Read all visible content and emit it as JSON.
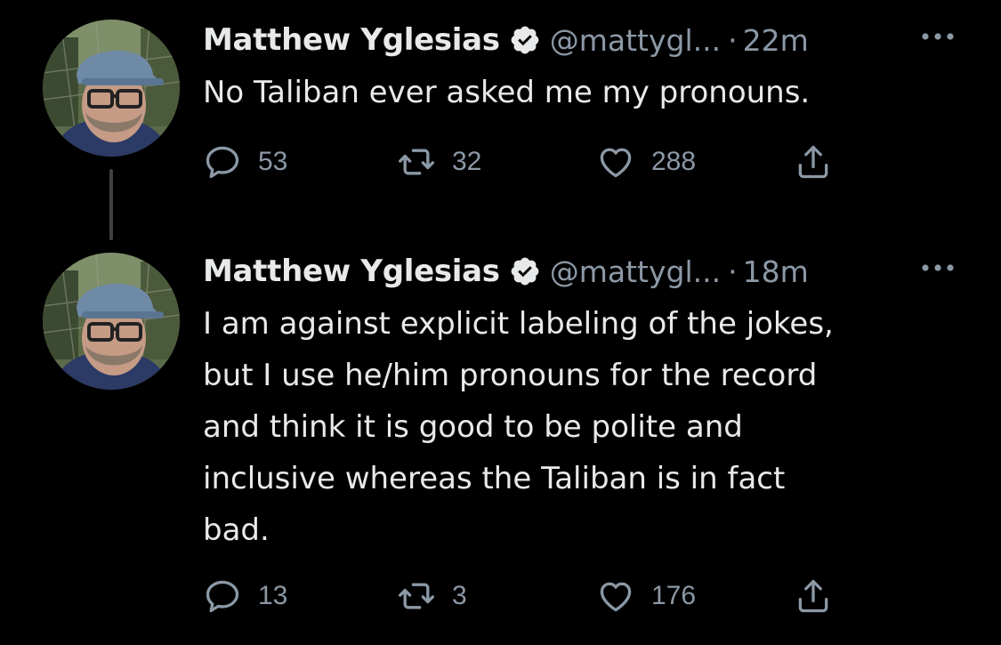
{
  "colors": {
    "background": "#000000",
    "text_primary": "#e7e9ea",
    "text_secondary": "#8b98a5",
    "thread_line": "#3e4144"
  },
  "tweets": [
    {
      "author": {
        "name": "Matthew Yglesias",
        "handle": "@mattygl...",
        "verified_icon": "verified-badge-icon"
      },
      "separator": "·",
      "time": "22m",
      "more_icon": "more-horizontal-icon",
      "text": "No Taliban ever asked me my pronouns.",
      "actions": {
        "reply": {
          "icon": "reply-icon",
          "count": "53"
        },
        "retweet": {
          "icon": "retweet-icon",
          "count": "32"
        },
        "like": {
          "icon": "heart-icon",
          "count": "288"
        },
        "share": {
          "icon": "share-icon"
        }
      }
    },
    {
      "author": {
        "name": "Matthew Yglesias",
        "handle": "@mattygl...",
        "verified_icon": "verified-badge-icon"
      },
      "separator": "·",
      "time": "18m",
      "more_icon": "more-horizontal-icon",
      "text": "I am against explicit labeling of the jokes,\nbut I use he/him pronouns for the record\nand think it is good to be polite and\ninclusive whereas the Taliban is in fact\nbad.",
      "actions": {
        "reply": {
          "icon": "reply-icon",
          "count": "13"
        },
        "retweet": {
          "icon": "retweet-icon",
          "count": "3"
        },
        "like": {
          "icon": "heart-icon",
          "count": "176"
        },
        "share": {
          "icon": "share-icon"
        }
      }
    }
  ]
}
